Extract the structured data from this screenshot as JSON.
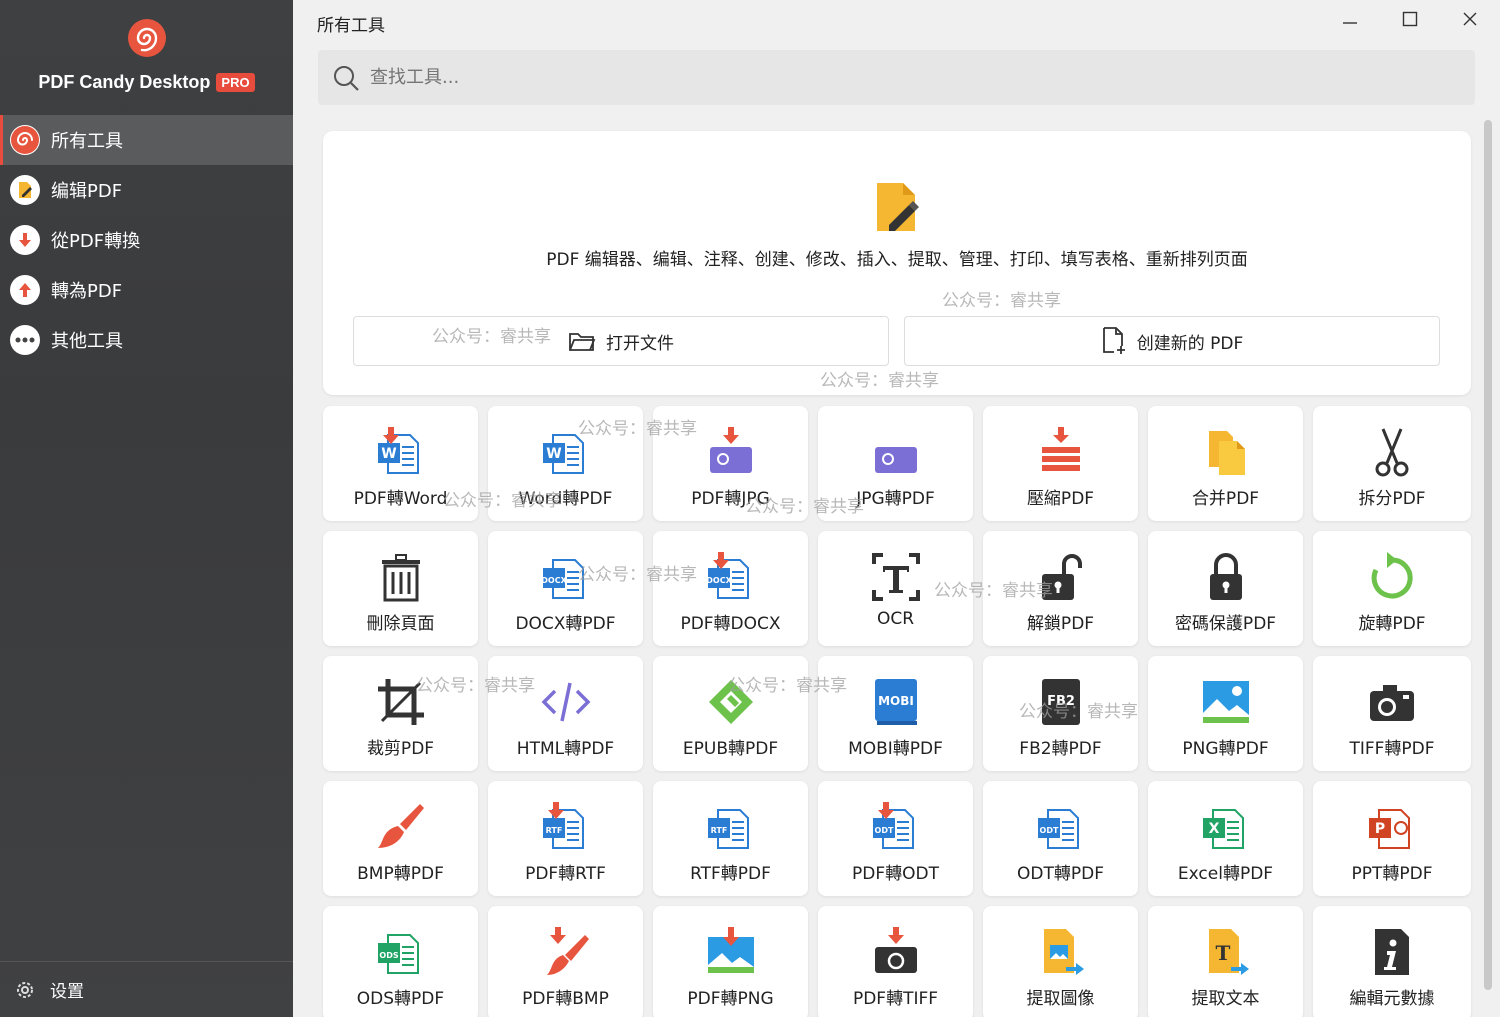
{
  "window": {
    "title": "所有工具"
  },
  "brand": {
    "name": "PDF Candy Desktop",
    "badge": "PRO"
  },
  "nav": [
    {
      "label": "所有工具",
      "icon": "candy-icon",
      "active": true
    },
    {
      "label": "编辑PDF",
      "icon": "edit-icon",
      "active": false
    },
    {
      "label": "從PDF轉換",
      "icon": "arrow-down-icon",
      "active": false
    },
    {
      "label": "轉為PDF",
      "icon": "arrow-up-icon",
      "active": false
    },
    {
      "label": "其他工具",
      "icon": "more-icon",
      "active": false
    }
  ],
  "settings": {
    "label": "设置"
  },
  "search": {
    "placeholder": "查找工具..."
  },
  "featured": {
    "description": "PDF 编辑器、编辑、注释、创建、修改、插入、提取、管理、打印、填写表格、重新排列页面",
    "open_label": "打开文件",
    "create_label": "创建新的 PDF"
  },
  "tools": [
    {
      "label": "PDF轉Word",
      "icon": "word-from-pdf-icon"
    },
    {
      "label": "Word轉PDF",
      "icon": "word-icon"
    },
    {
      "label": "PDF轉JPG",
      "icon": "jpg-from-pdf-icon"
    },
    {
      "label": "JPG轉PDF",
      "icon": "jpg-icon"
    },
    {
      "label": "壓縮PDF",
      "icon": "compress-icon"
    },
    {
      "label": "合并PDF",
      "icon": "merge-icon"
    },
    {
      "label": "拆分PDF",
      "icon": "scissors-icon"
    },
    {
      "label": "刪除頁面",
      "icon": "trash-icon"
    },
    {
      "label": "DOCX轉PDF",
      "icon": "docx-icon"
    },
    {
      "label": "PDF轉DOCX",
      "icon": "docx-from-pdf-icon"
    },
    {
      "label": "OCR",
      "icon": "ocr-icon"
    },
    {
      "label": "解鎖PDF",
      "icon": "unlock-icon"
    },
    {
      "label": "密碼保護PDF",
      "icon": "lock-icon"
    },
    {
      "label": "旋轉PDF",
      "icon": "rotate-icon"
    },
    {
      "label": "裁剪PDF",
      "icon": "crop-icon"
    },
    {
      "label": "HTML轉PDF",
      "icon": "html-icon"
    },
    {
      "label": "EPUB轉PDF",
      "icon": "epub-icon"
    },
    {
      "label": "MOBI轉PDF",
      "icon": "mobi-icon"
    },
    {
      "label": "FB2轉PDF",
      "icon": "fb2-icon"
    },
    {
      "label": "PNG轉PDF",
      "icon": "png-icon"
    },
    {
      "label": "TIFF轉PDF",
      "icon": "camera-icon"
    },
    {
      "label": "BMP轉PDF",
      "icon": "brush-icon"
    },
    {
      "label": "PDF轉RTF",
      "icon": "rtf-from-pdf-icon"
    },
    {
      "label": "RTF轉PDF",
      "icon": "rtf-icon"
    },
    {
      "label": "PDF轉ODT",
      "icon": "odt-from-pdf-icon"
    },
    {
      "label": "ODT轉PDF",
      "icon": "odt-icon"
    },
    {
      "label": "Excel轉PDF",
      "icon": "excel-icon"
    },
    {
      "label": "PPT轉PDF",
      "icon": "ppt-icon"
    },
    {
      "label": "ODS轉PDF",
      "icon": "ods-icon"
    },
    {
      "label": "PDF轉BMP",
      "icon": "bmp-from-pdf-icon"
    },
    {
      "label": "PDF轉PNG",
      "icon": "png-from-pdf-icon"
    },
    {
      "label": "PDF轉TIFF",
      "icon": "tiff-from-pdf-icon"
    },
    {
      "label": "提取圖像",
      "icon": "extract-image-icon"
    },
    {
      "label": "提取文本",
      "icon": "extract-text-icon"
    },
    {
      "label": "編輯元數據",
      "icon": "metadata-icon"
    }
  ],
  "watermark": "公众号：睿共享",
  "colors": {
    "accent": "#e74c3c",
    "word": "#2b7cd3",
    "excel": "#21a366",
    "ppt": "#d04423",
    "green": "#6cc24a",
    "purple": "#7b6fd6"
  }
}
